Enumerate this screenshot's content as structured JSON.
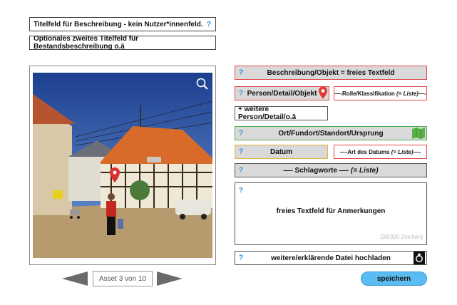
{
  "titles": {
    "title1": "Titelfeld für Beschreibung - kein Nutzer*innenfeld.",
    "title1_help": "?",
    "title2": "Optionales zweites Titelfeld für Bestandsbeschreibung o.ä"
  },
  "fields": {
    "help": "?",
    "beschreibung": "Beschreibung/Objekt = freies Textfeld",
    "person": "Person/Detail/Objekt",
    "rolle_prefix": "—-Rolle/Klassifikation ",
    "rolle_suffix": "(= Liste)",
    "rolle_end": "—-",
    "weitere_person": "+  weitere Person/Detail/o.ä",
    "ort": "Ort/Fundort/Standort/Ursprung",
    "datum": "Datum",
    "art_prefix": "—-Art des Datums ",
    "art_suffix": "(= Liste)",
    "art_end": "—-",
    "schlagworte": "—- Schlagworte —- ",
    "schlagworte_suffix": "(= Liste)",
    "anmerkungen": "freies Textfeld für Anmerkungen",
    "char_count": "[30/300 Zeichen]",
    "upload": "weitere/erklärende Datei hochladen"
  },
  "navigation": {
    "asset_label": "Asset 3 von 10"
  },
  "actions": {
    "save": "speichern"
  },
  "colors": {
    "help": "#2a8fd6",
    "red_border": "#e14b4b",
    "green_border": "#4fae4f",
    "gold_border": "#e6b23a",
    "save_button": "#5bbcf2",
    "field_gray": "#d9d9d9"
  },
  "icons": [
    "zoom-icon",
    "map-pin-icon",
    "map-icon",
    "upload-file-icon",
    "arrow-left-icon",
    "arrow-right-icon"
  ]
}
